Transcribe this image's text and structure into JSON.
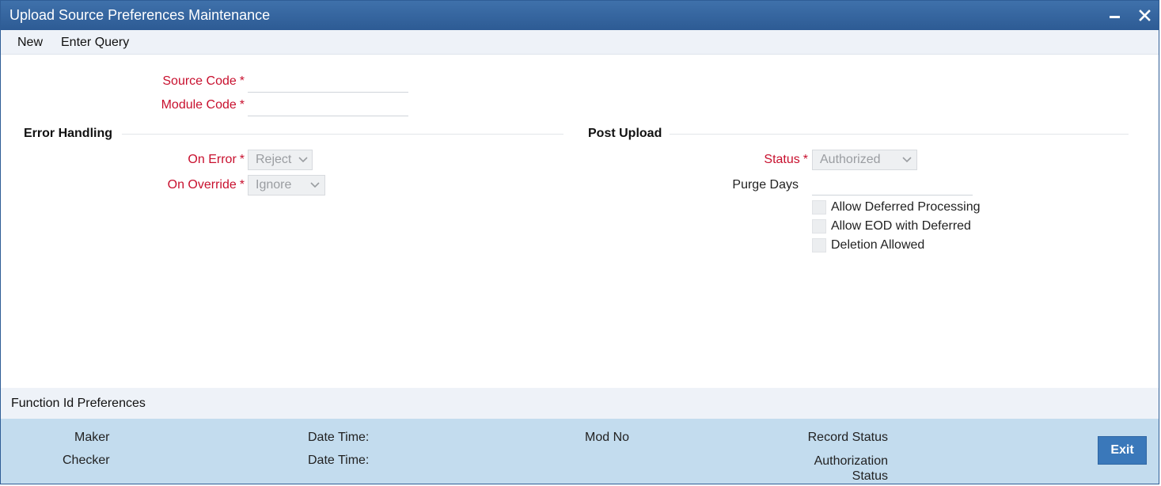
{
  "window": {
    "title": "Upload Source Preferences Maintenance"
  },
  "toolbar": {
    "new_label": "New",
    "enter_query_label": "Enter Query"
  },
  "form": {
    "source_code": {
      "label": "Source Code",
      "value": ""
    },
    "module_code": {
      "label": "Module Code",
      "value": ""
    },
    "required_marker": "*"
  },
  "error_handling": {
    "title": "Error Handling",
    "on_error": {
      "label": "On Error",
      "value": "Reject"
    },
    "on_override": {
      "label": "On Override",
      "value": "Ignore"
    }
  },
  "post_upload": {
    "title": "Post Upload",
    "status": {
      "label": "Status",
      "value": "Authorized"
    },
    "purge_days": {
      "label": "Purge Days",
      "value": ""
    },
    "checkboxes": [
      {
        "label": "Allow Deferred Processing",
        "checked": false
      },
      {
        "label": "Allow EOD with Deferred",
        "checked": false
      },
      {
        "label": "Deletion Allowed",
        "checked": false
      }
    ]
  },
  "function_id_preferences": {
    "label": "Function Id Preferences"
  },
  "footer": {
    "maker_label": "Maker",
    "checker_label": "Checker",
    "date_time_label": "Date Time:",
    "mod_no_label": "Mod No",
    "record_status_label": "Record Status",
    "authorization_status_line1": "Authorization",
    "authorization_status_line2": "Status",
    "exit_label": "Exit"
  },
  "colors": {
    "title_bar": "#2d5b94",
    "required_label": "#c8102e",
    "footer_bg": "#c3dcee",
    "exit_button": "#3a78ba"
  },
  "icons": {
    "minimize": "minimize-icon",
    "close": "close-icon",
    "dropdown": "chevron-down-icon"
  }
}
